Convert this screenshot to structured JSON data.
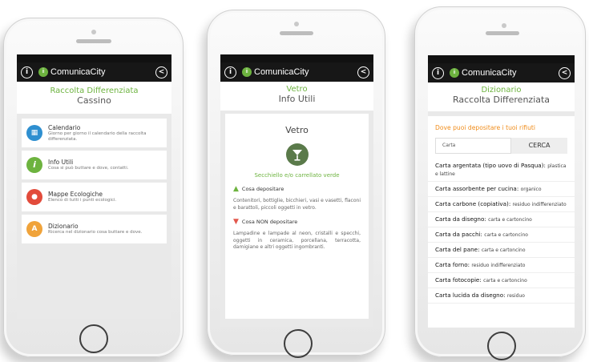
{
  "app": {
    "brand": "ComunicaCity",
    "logo_text": "ii",
    "info_glyph": "i",
    "back_glyph": "<"
  },
  "phone1": {
    "title": "Raccolta Differenziata",
    "subtitle": "Cassino",
    "menu": [
      {
        "id": "calendario",
        "title": "Calendario",
        "desc": "Giorno per giorno il calendario della raccolta differenziata.",
        "color": "#2e8fd0",
        "icon": "calendar-icon",
        "glyph": "▦"
      },
      {
        "id": "info-utili",
        "title": "Info Utili",
        "desc": "Cosa si può buttare e dove, contatti.",
        "color": "#6db33f",
        "icon": "info-icon",
        "glyph": "i"
      },
      {
        "id": "mappe-ecologiche",
        "title": "Mappe Ecologiche",
        "desc": "Elenco di tutti i punti ecologici.",
        "color": "#e24b3b",
        "icon": "map-pin-icon",
        "glyph": "●"
      },
      {
        "id": "dizionario",
        "title": "Dizionario",
        "desc": "Ricerca nel dizionario cosa buttare e dove.",
        "color": "#f0a33a",
        "icon": "dictionary-icon",
        "glyph": "A"
      }
    ]
  },
  "phone2": {
    "title": "Vetro",
    "subtitle": "Info Utili",
    "section_title": "Vetro",
    "container": "Secchiello e/o carrellato verde",
    "ok_label": "Cosa depositare",
    "ok_text": "Contenitori, bottiglie, bicchieri, vasi e vasetti, flaconi e barattoli, piccoli oggetti in vetro.",
    "no_label": "Cosa NON depositare",
    "no_text": "Lampadine e lampade al neon, cristalli e specchi, oggetti in ceramica, porcellana, terracotta, damigiane e altri oggetti ingombranti.",
    "accent": "#6db33f",
    "ok_color": "#6db33f",
    "no_color": "#e2574c"
  },
  "phone3": {
    "title": "Dizionario",
    "subtitle": "Raccolta Differenziata",
    "heading": "Dove puoi depositare i tuoi rifiuti",
    "search_value": "Carta",
    "search_button": "CERCA",
    "accent": "#f08c1a",
    "items": [
      {
        "term": "Carta argentata (tipo uovo di Pasqua):",
        "def": "plastica e lattine"
      },
      {
        "term": "Carta assorbente per cucina:",
        "def": "organico"
      },
      {
        "term": "Carta carbone (copiativa):",
        "def": "residuo indifferenziato"
      },
      {
        "term": "Carta da disegno:",
        "def": "carta e cartoncino"
      },
      {
        "term": "Carta da pacchi:",
        "def": "carta e cartoncino"
      },
      {
        "term": "Carta del pane:",
        "def": "carta e cartoncino"
      },
      {
        "term": "Carta forno:",
        "def": "residuo indifferenziato"
      },
      {
        "term": "Carta fotocopie:",
        "def": "carta e cartoncino"
      },
      {
        "term": "Carta lucida da disegno:",
        "def": "residuo"
      }
    ]
  }
}
